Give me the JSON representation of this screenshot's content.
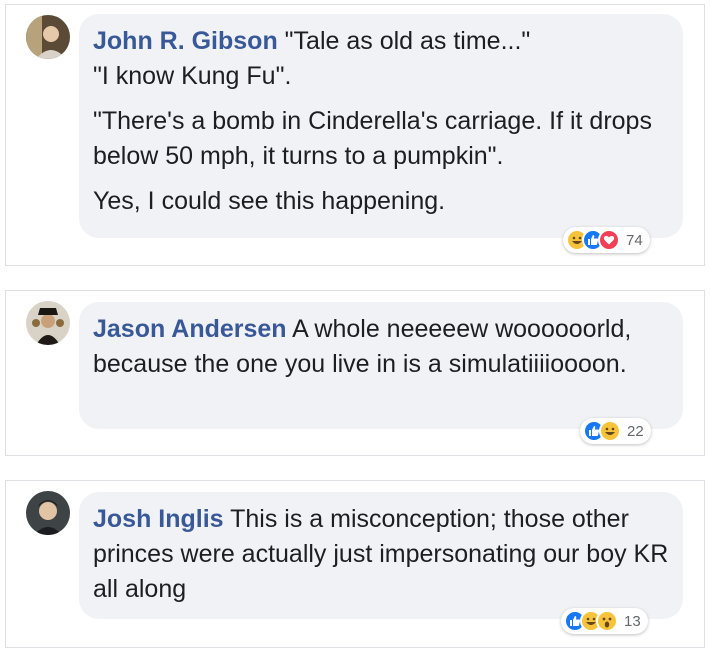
{
  "comments": [
    {
      "author": "John R. Gibson",
      "lines": [
        "\"Tale as old as time...\"",
        "\"I know Kung Fu\".",
        "\"There's a bomb in Cinderella's carriage. If it drops below 50 mph, it turns to a pumpkin\".",
        "Yes, I could see this happening."
      ],
      "reactions": [
        "haha-icon",
        "like-icon",
        "love-icon"
      ],
      "reaction_count": "74"
    },
    {
      "author": "Jason Andersen",
      "text": "A whole neeeeew woooooorld, because the one you live in is a simulatiiiioooon.",
      "reactions": [
        "like-icon",
        "haha-icon"
      ],
      "reaction_count": "22"
    },
    {
      "author": "Josh Inglis",
      "text": "This is a misconception; those other princes were actually just impersonating our boy KR all along",
      "reactions": [
        "like-icon",
        "haha-icon",
        "wow-icon"
      ],
      "reaction_count": "13"
    }
  ],
  "colors": {
    "author_name": "#385898",
    "bubble_bg": "#f0f2f5",
    "text": "#1c1e21",
    "like": "#1877f2",
    "love": "#f33e58",
    "haha": "#f7c33b"
  }
}
